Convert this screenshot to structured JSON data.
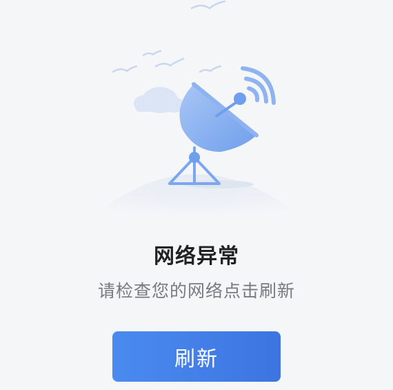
{
  "error_state": {
    "illustration_icon": "satellite-dish-icon",
    "title": "网络异常",
    "message": "请检查您的网络点击刷新",
    "refresh_label": "刷新"
  },
  "colors": {
    "background": "#f5f6f8",
    "title": "#222222",
    "message": "#777a80",
    "button_start": "#4a8bf0",
    "button_end": "#3d74e0",
    "button_text": "#ffffff",
    "illustration_blue": "#6fa0ec"
  }
}
